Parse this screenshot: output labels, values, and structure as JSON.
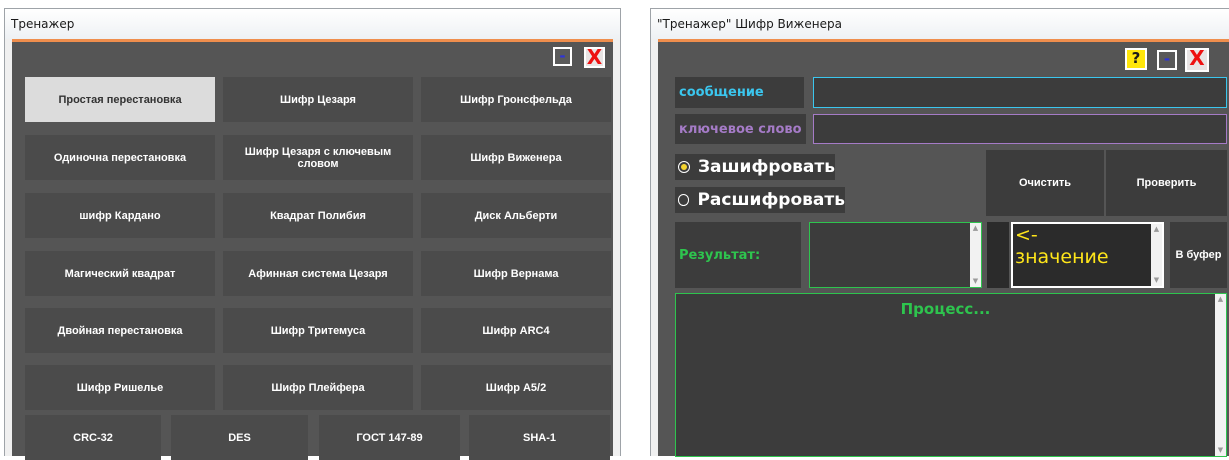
{
  "window1": {
    "title": "Тренажер",
    "minimize_label": "-",
    "close_label": "X",
    "ciphers": [
      "Простая перестановка",
      "Шифр Цезаря",
      "Шифр Гронсфельда",
      "Одиночна перестановка",
      "Шифр Цезаря с ключевым словом",
      "Шифр Виженера",
      "шифр Кардано",
      "Квадрат Полибия",
      "Диск Альберти",
      "Магический квадрат",
      "Афинная система Цезаря",
      "Шифр Вернама",
      "Двойная перестановка",
      "Шифр Тритемуса",
      "Шифр ARC4",
      "Шифр Ришелье",
      "Шифр Плейфера",
      "Шифр А5/2"
    ],
    "hashes": [
      "CRC-32",
      "DES",
      "ГОСТ 147-89",
      "SHA-1"
    ],
    "selected": "Простая перестановка"
  },
  "window2": {
    "title": "\"Тренажер\" Шифр Виженера",
    "help_label": "?",
    "minimize_label": "-",
    "close_label": "X",
    "message_label": "сообщение",
    "message_value": "",
    "key_label": "ключевое слово",
    "key_value": "",
    "encrypt_label": "Зашифровать",
    "decrypt_label": "Расшифровать",
    "mode_selected": "encrypt",
    "clear_label": "Очистить",
    "check_label": "Проверить",
    "result_label": "Результат:",
    "result_value": "",
    "value_text": "<-\nзначение",
    "buffer_label": "В буфер",
    "process_label": "Процесс...",
    "colors": {
      "message": "#3bc6ee",
      "key": "#a57bc7",
      "result": "#2ec44e",
      "value_text": "#ffe61a",
      "accent": "#ef8e4d"
    }
  }
}
